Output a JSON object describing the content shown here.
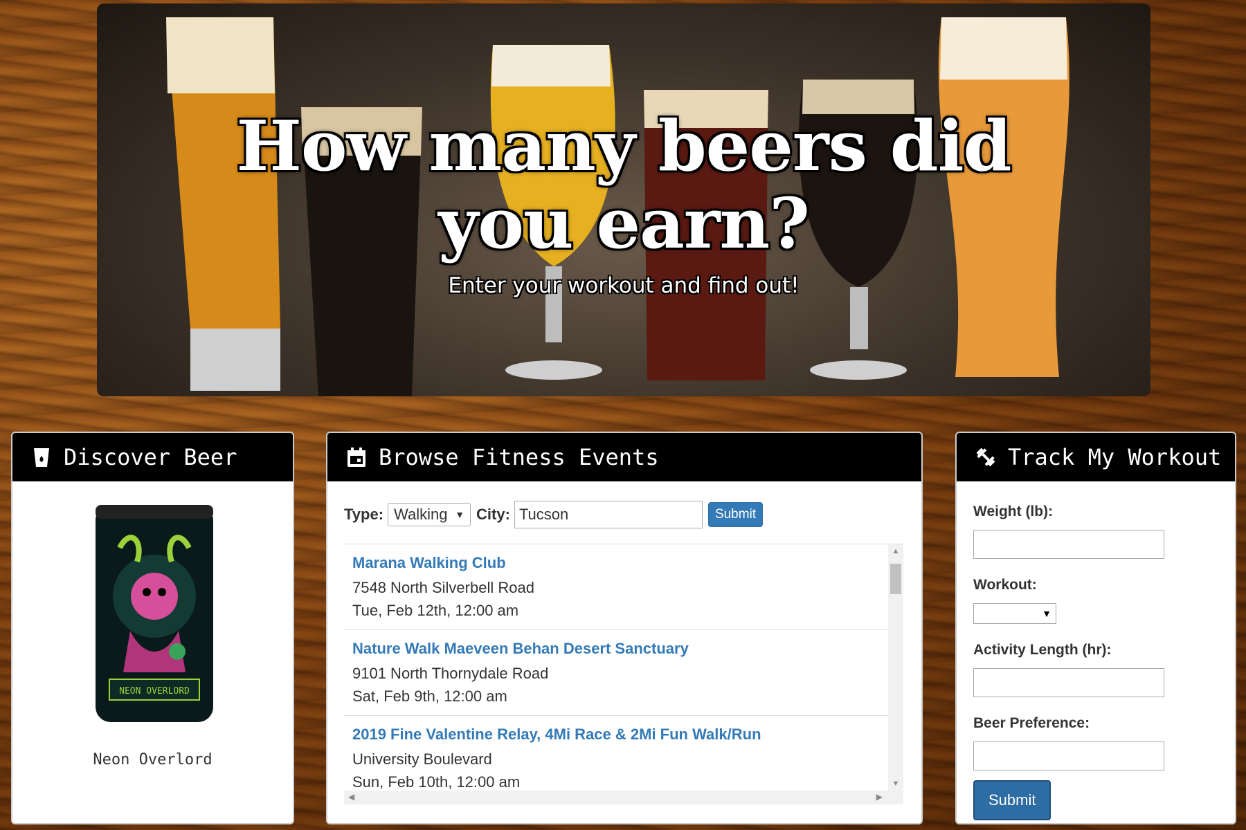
{
  "hero": {
    "title": "How many beers did you earn?",
    "subtitle": "Enter your workout and find out!"
  },
  "discover": {
    "heading": "Discover Beer",
    "beer_name": "Neon Overlord",
    "can_label": "NEON OVERLORD"
  },
  "events": {
    "heading": "Browse Fitness Events",
    "type_label": "Type:",
    "type_value": "Walking",
    "city_label": "City:",
    "city_value": "Tucson",
    "submit_label": "Submit",
    "items": [
      {
        "title": "Marana Walking Club",
        "address": "7548 North Silverbell Road",
        "date": "Tue, Feb 12th, 12:00 am"
      },
      {
        "title": "Nature Walk Maeveen Behan Desert Sanctuary",
        "address": "9101 North Thornydale Road",
        "date": "Sat, Feb 9th, 12:00 am"
      },
      {
        "title": "2019 Fine Valentine Relay, 4Mi Race & 2Mi Fun Walk/Run",
        "address": "University Boulevard",
        "date": "Sun, Feb 10th, 12:00 am"
      }
    ]
  },
  "workout": {
    "heading": "Track My Workout",
    "weight_label": "Weight (lb):",
    "workout_label": "Workout:",
    "length_label": "Activity Length (hr):",
    "beer_pref_label": "Beer Preference:",
    "submit_label": "Submit"
  },
  "colors": {
    "link_blue": "#337ab7",
    "button_blue": "#2e6da4",
    "panel_header": "#000000"
  }
}
